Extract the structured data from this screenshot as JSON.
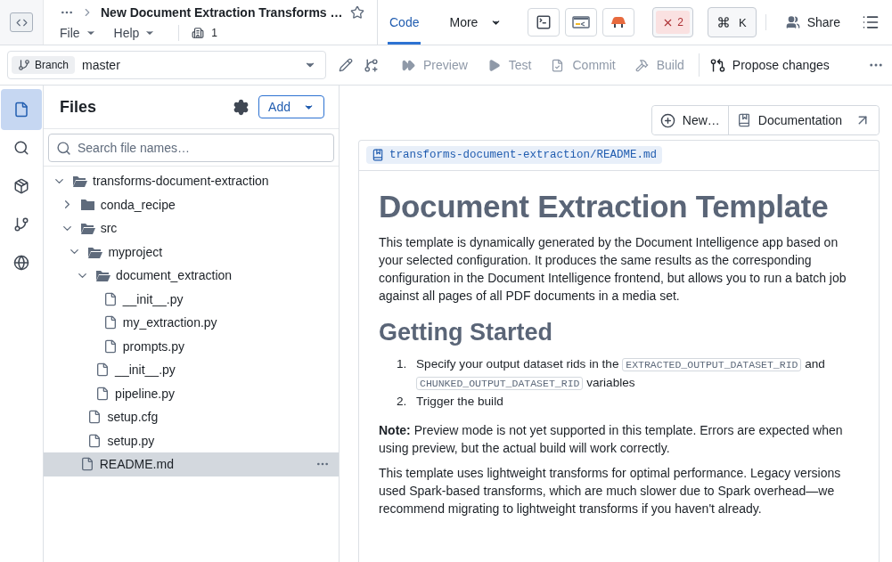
{
  "header": {
    "title": "New Document Extraction Transforms …",
    "menus": [
      {
        "label": "File"
      },
      {
        "label": "Help"
      }
    ],
    "org_count": "1",
    "tabs": [
      {
        "label": "Code",
        "selected": true,
        "dropdown": false
      },
      {
        "label": "More",
        "selected": false,
        "dropdown": true
      }
    ],
    "error_count": "2",
    "shortcut_key": "K",
    "share": "Share"
  },
  "toolbar": {
    "branch_label": "Branch",
    "branch": "master",
    "actions": [
      {
        "kind": "preview",
        "label": "Preview",
        "disabled": true
      },
      {
        "kind": "test",
        "label": "Test",
        "disabled": true
      },
      {
        "kind": "commit",
        "label": "Commit",
        "disabled": true
      },
      {
        "kind": "build",
        "label": "Build",
        "disabled": true
      }
    ],
    "propose": "Propose changes"
  },
  "rail": [
    {
      "kind": "files",
      "selected": true
    },
    {
      "kind": "search",
      "selected": false
    },
    {
      "kind": "package",
      "selected": false
    },
    {
      "kind": "branches",
      "selected": false
    },
    {
      "kind": "globe",
      "selected": false
    }
  ],
  "files": {
    "title": "Files",
    "add": "Add",
    "search_placeholder": "Search file names…",
    "tree": [
      {
        "kind": "folder",
        "name": "transforms-document-extraction",
        "expanded": true,
        "selected": false,
        "children": [
          {
            "kind": "folder",
            "name": "conda_recipe",
            "expanded": false,
            "selected": false
          },
          {
            "kind": "folder",
            "name": "src",
            "expanded": true,
            "selected": false,
            "children": [
              {
                "kind": "folder",
                "name": "myproject",
                "expanded": true,
                "selected": false,
                "children": [
                  {
                    "kind": "folder",
                    "name": "document_extraction",
                    "expanded": true,
                    "selected": false,
                    "children": [
                      {
                        "kind": "file",
                        "name": "__init__.py",
                        "selected": false
                      },
                      {
                        "kind": "file",
                        "name": "my_extraction.py",
                        "selected": false
                      },
                      {
                        "kind": "file",
                        "name": "prompts.py",
                        "selected": false
                      }
                    ]
                  },
                  {
                    "kind": "file",
                    "name": "__init__.py",
                    "selected": false
                  },
                  {
                    "kind": "file",
                    "name": "pipeline.py",
                    "selected": false
                  }
                ]
              },
              {
                "kind": "file",
                "name": "setup.cfg",
                "selected": false
              },
              {
                "kind": "file",
                "name": "setup.py",
                "selected": false
              }
            ]
          },
          {
            "kind": "file",
            "name": "README.md",
            "selected": true
          }
        ]
      }
    ]
  },
  "content": {
    "new_button": "New…",
    "docs_button": "Documentation",
    "path": "transforms-document-extraction/README.md",
    "blocks": [
      {
        "kind": "h1",
        "text": "Document Extraction Template"
      },
      {
        "kind": "p",
        "text": "This template is dynamically generated by the Document Intelligence app based on your selected configuration. It produces the same results as the corresponding configuration in the Document Intelligence frontend, but allows you to run a batch job against all pages of all PDF documents in a media set."
      },
      {
        "kind": "h2",
        "text": "Getting Started"
      },
      {
        "kind": "ol",
        "items": [
          {
            "number": "1.",
            "segments": [
              {
                "kind": "text",
                "text": "Specify your output dataset rids in the"
              },
              {
                "kind": "code",
                "text": "EXTRACTED_OUTPUT_DATASET_RID"
              },
              {
                "kind": "text",
                "text": "and"
              },
              {
                "kind": "code",
                "text": "CHUNKED_OUTPUT_DATASET_RID"
              },
              {
                "kind": "text",
                "text": "variables"
              }
            ]
          },
          {
            "number": "2.",
            "segments": [
              {
                "kind": "text",
                "text": "Trigger the build"
              }
            ]
          }
        ]
      },
      {
        "kind": "p",
        "text": "**Note:** Preview mode is not yet supported in this template. Errors are expected when using preview, but the actual build will work correctly."
      },
      {
        "kind": "p",
        "text": "This template uses lightweight transforms for optimal performance. Legacy versions used Spark-based transforms, which are much slower due to Spark overhead—we recommend migrating to lightweight transforms if you haven't already."
      }
    ]
  }
}
